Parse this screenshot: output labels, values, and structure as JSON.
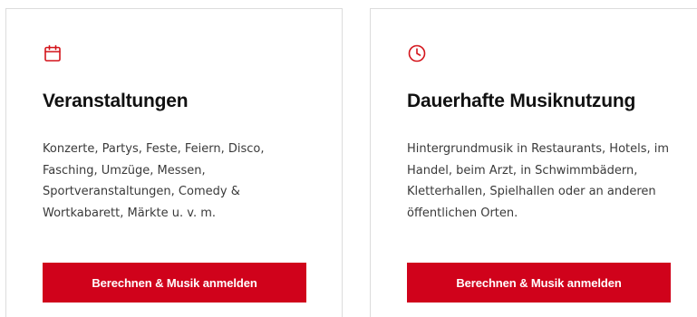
{
  "colors": {
    "accent": "#d0021b",
    "card_border": "#dcdcdc",
    "text": "#3a3a3a"
  },
  "cards": [
    {
      "icon": "calendar-icon",
      "title": "Veranstaltungen",
      "text": "Konzerte, Partys, Feste, Feiern, Disco, Fasching, Umzüge, Messen, Sportveranstaltungen, Comedy & Wortkabarett, Märkte u. v. m.",
      "button_label": "Berechnen & Musik anmelden"
    },
    {
      "icon": "clock-icon",
      "title": "Dauerhafte Musiknutzung",
      "text": "Hintergrundmusik in Restaurants, Hotels, im Handel, beim Arzt, in Schwimmbädern, Kletterhallen, Spielhallen oder an anderen öffentlichen Orten.",
      "button_label": "Berechnen & Musik anmelden"
    }
  ]
}
